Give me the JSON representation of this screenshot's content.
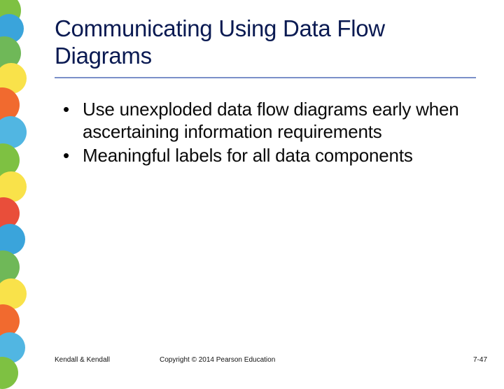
{
  "slide": {
    "title": "Communicating Using Data Flow Diagrams",
    "bullets": [
      "Use unexploded data flow diagrams early when ascertaining information requirements",
      "Meaningful labels for all data components"
    ]
  },
  "footer": {
    "author": "Kendall & Kendall",
    "copyright": "Copyright © 2014 Pearson Education",
    "page": "7-47"
  }
}
